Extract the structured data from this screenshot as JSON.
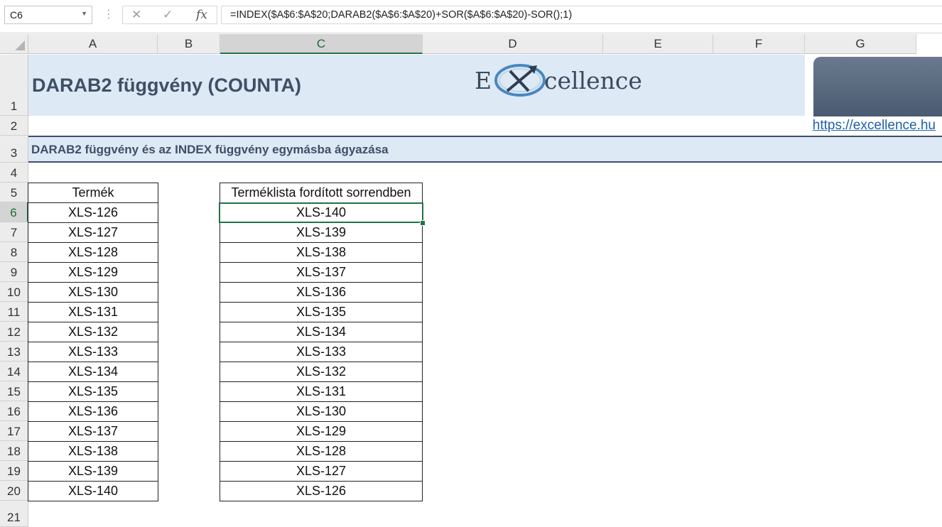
{
  "namebox": {
    "value": "C6"
  },
  "formula_bar": {
    "cancel_icon": "✕",
    "enter_icon": "✓",
    "fx_label": "fx",
    "formula": "=INDEX($A$6:$A$20;DARAB2($A$6:$A$20)+SOR($A$6:$A$20)-SOR();1)"
  },
  "columns": [
    "A",
    "B",
    "C",
    "D",
    "E",
    "F",
    "G"
  ],
  "rows": [
    "1",
    "2",
    "3",
    "4",
    "5",
    "6",
    "7",
    "8",
    "9",
    "10",
    "11",
    "12",
    "13",
    "14",
    "15",
    "16",
    "17",
    "18",
    "19",
    "20",
    "21"
  ],
  "selected": {
    "column": "C",
    "row": "6"
  },
  "sheet": {
    "title": "DARAB2 függvény (COUNTA)",
    "logo_e": "E",
    "logo_rest": "cellence",
    "link": "https://excellence.hu",
    "subtitle": "DARAB2 függvény és az INDEX függvény egymásba ágyazása"
  },
  "table_products": {
    "header": "Termék",
    "items": [
      "XLS-126",
      "XLS-127",
      "XLS-128",
      "XLS-129",
      "XLS-130",
      "XLS-131",
      "XLS-132",
      "XLS-133",
      "XLS-134",
      "XLS-135",
      "XLS-136",
      "XLS-137",
      "XLS-138",
      "XLS-139",
      "XLS-140"
    ]
  },
  "table_reversed": {
    "header": "Terméklista fordított sorrendben",
    "items": [
      "XLS-140",
      "XLS-139",
      "XLS-138",
      "XLS-137",
      "XLS-136",
      "XLS-135",
      "XLS-134",
      "XLS-133",
      "XLS-132",
      "XLS-131",
      "XLS-130",
      "XLS-129",
      "XLS-128",
      "XLS-127",
      "XLS-126"
    ]
  },
  "colors": {
    "accent": "#217346",
    "band": "#dde9f5",
    "title": "#3f4f66",
    "link": "#1f5faa"
  }
}
